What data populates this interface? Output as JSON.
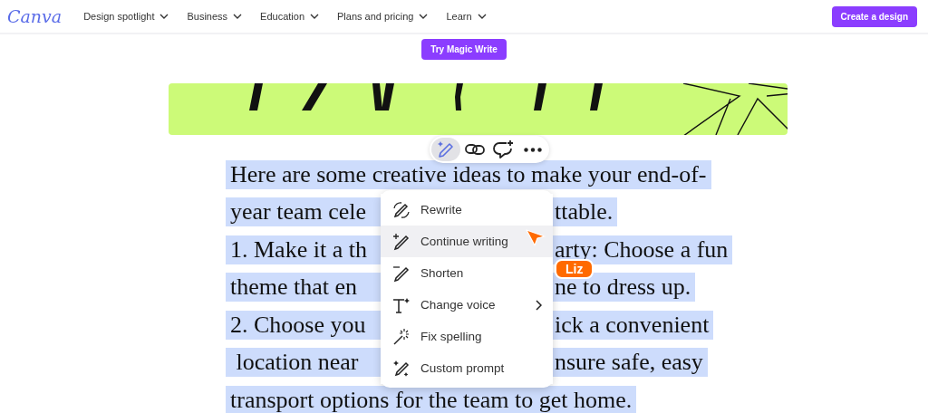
{
  "header": {
    "logo": "Canva",
    "nav": [
      {
        "label": "Design spotlight"
      },
      {
        "label": "Business"
      },
      {
        "label": "Education"
      },
      {
        "label": "Plans and pricing"
      },
      {
        "label": "Learn"
      }
    ],
    "cta": "Create a design"
  },
  "magic_button": "Try Magic Write",
  "toolbar": [
    {
      "kind": "magic",
      "selected": true
    },
    {
      "kind": "link",
      "selected": false
    },
    {
      "kind": "comment",
      "selected": false
    },
    {
      "kind": "more",
      "selected": false
    }
  ],
  "text_lines": [
    {
      "parts": [
        "Here are some creative ideas to make your end-of-"
      ]
    },
    {
      "parts": [
        "year team cele",
        "ttable."
      ]
    },
    {
      "parts": [
        "1. Make it a th",
        "arty: Choose a fun"
      ]
    },
    {
      "parts": [
        "theme that en",
        "ne to dress up."
      ]
    },
    {
      "parts": [
        "2. Choose you",
        "ick a convenient"
      ]
    },
    {
      "parts": [
        " location near",
        "nsure safe, easy"
      ]
    },
    {
      "parts": [
        "transport options for the team to get home."
      ]
    }
  ],
  "menu": [
    {
      "kind": "rewrite",
      "label": "Rewrite",
      "selected": false,
      "has_submenu": false
    },
    {
      "kind": "continue",
      "label": "Continue writing",
      "selected": true,
      "has_submenu": false
    },
    {
      "kind": "shorten",
      "label": "Shorten",
      "selected": false,
      "has_submenu": false
    },
    {
      "kind": "voice",
      "label": "Change voice",
      "selected": false,
      "has_submenu": true
    },
    {
      "kind": "spelling",
      "label": "Fix spelling",
      "selected": false,
      "has_submenu": false
    },
    {
      "kind": "custom",
      "label": "Custom prompt",
      "selected": false,
      "has_submenu": false
    }
  ],
  "cursor": {
    "name": "Liz"
  }
}
